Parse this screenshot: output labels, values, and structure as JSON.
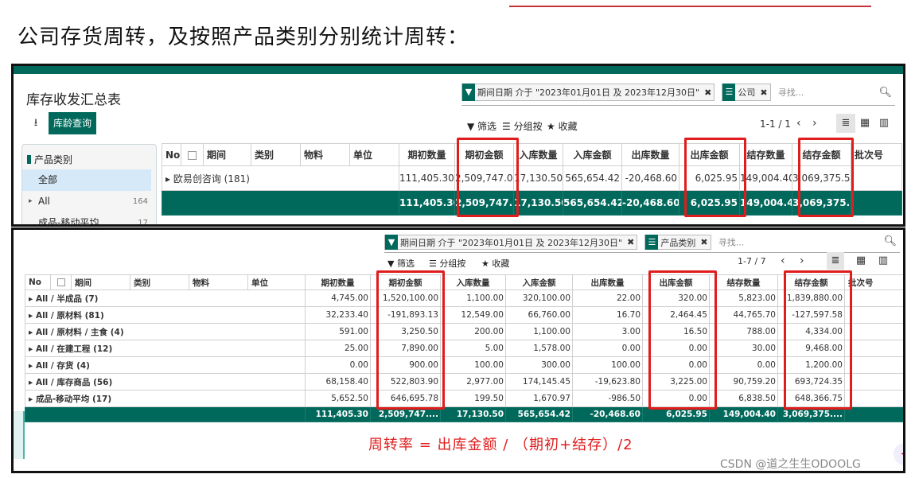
{
  "page": {
    "heading": "公司存货周转，及按照产品类别分别统计周转：",
    "formula": "周转率 = 出库金额 / （期初+结存）/2",
    "watermark": "CSDN @道之生生ODOOLG"
  },
  "panel1": {
    "title": "库存收发汇总表",
    "download_icon": "download-icon",
    "report_button": "库龄查询",
    "facets": [
      {
        "icon": "filter-icon",
        "label": "期间日期 介于 \"2023年01月01日 及 2023年12月30日\""
      },
      {
        "icon": "group-icon",
        "label": "公司"
      }
    ],
    "search_placeholder": "寻找...",
    "filters_label": "筛选",
    "groupby_label": "分组按",
    "favorites_label": "收藏",
    "pager": "1-1 / 1",
    "sidebar": {
      "title": "产品类别",
      "items": [
        {
          "label": "全部",
          "count": "",
          "selected": true
        },
        {
          "label": "All",
          "count": "164",
          "selected": false
        },
        {
          "label": "成品-移动平均",
          "count": "17",
          "selected": false
        }
      ]
    },
    "columns": [
      "No",
      "",
      "期间",
      "类别",
      "物料",
      "单位",
      "期初数量",
      "期初金额",
      "入库数量",
      "入库金额",
      "出库数量",
      "出库金额",
      "结存数量",
      "结存金额",
      "批次号"
    ],
    "rows": [
      {
        "label": "欧易创咨询 (181)",
        "values": [
          "111,405.30",
          "2,509,747.05",
          "17,130.50",
          "565,654.42",
          "-20,468.60",
          "6,025.95",
          "149,004.40",
          "3,069,375.52"
        ]
      }
    ],
    "totals": [
      "111,405.30",
      "2,509,747....",
      "17,130.50",
      "565,654.42",
      "-20,468.60",
      "6,025.95",
      "149,004.40",
      "3,069,375...."
    ]
  },
  "panel2": {
    "facets": [
      {
        "icon": "filter-icon",
        "label": "期间日期 介于 \"2023年01月01日 及 2023年12月30日\""
      },
      {
        "icon": "group-icon",
        "label": "产品类别"
      }
    ],
    "search_placeholder": "寻找...",
    "filters_label": "筛选",
    "groupby_label": "分组按",
    "favorites_label": "收藏",
    "pager": "1-7 / 7",
    "columns": [
      "No",
      "",
      "期间",
      "类别",
      "物料",
      "单位",
      "期初数量",
      "期初金额",
      "入库数量",
      "入库金额",
      "出库数量",
      "出库金额",
      "结存数量",
      "结存金额",
      "批次号"
    ],
    "rows": [
      {
        "label": "All / 半成品 (7)",
        "values": [
          "4,745.00",
          "1,520,100.00",
          "1,100.00",
          "320,100.00",
          "22.00",
          "320.00",
          "5,823.00",
          "1,839,880.00"
        ]
      },
      {
        "label": "All / 原材料 (81)",
        "values": [
          "32,233.40",
          "-191,893.13",
          "12,549.00",
          "66,760.00",
          "16.70",
          "2,464.45",
          "44,765.70",
          "-127,597.58"
        ]
      },
      {
        "label": "All / 原材料 / 主食 (4)",
        "values": [
          "591.00",
          "3,250.50",
          "200.00",
          "1,100.00",
          "3.00",
          "16.50",
          "788.00",
          "4,334.00"
        ]
      },
      {
        "label": "All / 在建工程 (12)",
        "values": [
          "25.00",
          "7,890.00",
          "5.00",
          "1,578.00",
          "0.00",
          "0.00",
          "30.00",
          "9,468.00"
        ]
      },
      {
        "label": "All / 存货 (4)",
        "values": [
          "0.00",
          "900.00",
          "100.00",
          "300.00",
          "100.00",
          "0.00",
          "0.00",
          "1,200.00"
        ]
      },
      {
        "label": "All / 库存商品 (56)",
        "values": [
          "68,158.40",
          "522,803.90",
          "2,977.00",
          "174,145.45",
          "-19,623.80",
          "3,225.00",
          "90,759.20",
          "693,724.35"
        ]
      },
      {
        "label": "成品-移动平均 (17)",
        "values": [
          "5,652.50",
          "646,695.78",
          "199.50",
          "1,670.97",
          "-986.50",
          "0.00",
          "6,838.50",
          "648,366.75"
        ]
      }
    ],
    "totals": [
      "111,405.30",
      "2,509,747....",
      "17,130.50",
      "565,654.42",
      "-20,468.60",
      "6,025.95",
      "149,004.40",
      "3,069,375...."
    ]
  },
  "colors": {
    "primary": "#00695c",
    "highlight": "#e01c1c"
  }
}
